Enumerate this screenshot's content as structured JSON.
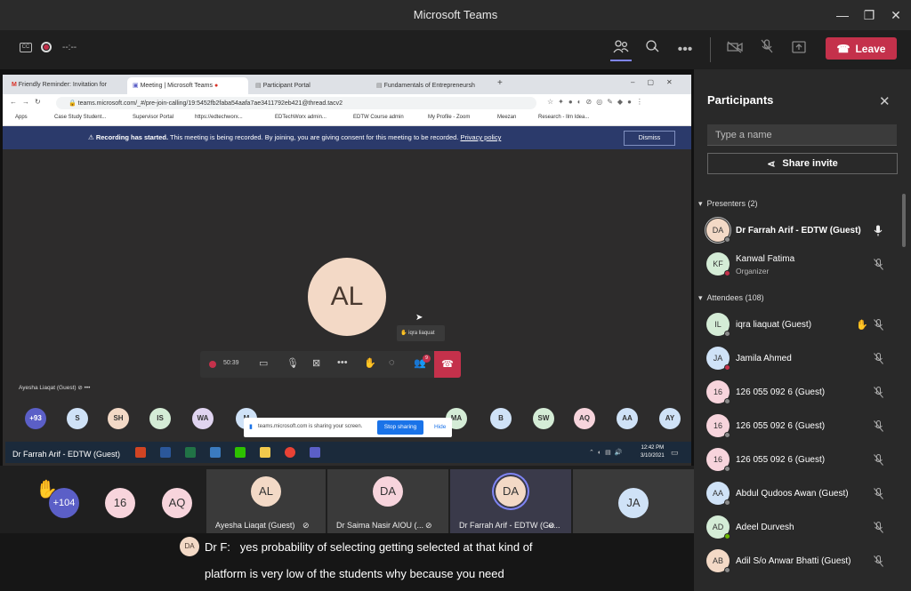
{
  "titlebar": {
    "title": "Microsoft Teams",
    "minimize": "—",
    "maximize": "❐",
    "close": "✕"
  },
  "meeting": {
    "timer": "--:--",
    "cc_icon": "cc-icon",
    "leave_label": "Leave",
    "leave_color": "#c4314b"
  },
  "browser": {
    "tabs": [
      "Friendly Reminder: Invitation for",
      "Meeting | Microsoft Teams",
      "Participant Portal",
      "Fundamentals of Entrepreneursh"
    ],
    "url": "teams.microsoft.com/_#/pre-join-calling/19:5452fb2faba54aafa7ae3411792eb421@thread.tacv2",
    "bookmarks": [
      "Apps",
      "Case Study Student...",
      "Supervisor Portal",
      "https://edtechworx...",
      "EDTechWorx admin...",
      "EDTW Course admin",
      "My Profile - Zoom",
      "Meezan",
      "Research - Ilm Idea..."
    ],
    "recording_bold": "Recording has started.",
    "recording_text": " This meeting is being recorded. By joining, you are giving consent for this meeting to be recorded. ",
    "privacy_link": "Privacy policy",
    "dismiss": "Dismiss",
    "big_avatar": "AL",
    "hand_tip": "iqra liaquat",
    "call_time": "50:39",
    "call_badge": "9",
    "speaker_label": "Ayesha Liaqat (Guest)",
    "mini_avatars": [
      {
        "t": "+93",
        "c": "#5b5fc7"
      },
      {
        "t": "S",
        "c": "#cfe2f7"
      },
      {
        "t": "SH",
        "c": "#f3d9c6"
      },
      {
        "t": "IS",
        "c": "#d4ecd6"
      },
      {
        "t": "WA",
        "c": "#e0d4f0"
      },
      {
        "t": "M",
        "c": "#cfe2f7"
      },
      {
        "t": "MA",
        "c": "#d4ecd6"
      },
      {
        "t": "B",
        "c": "#cfe2f7"
      },
      {
        "t": "SW",
        "c": "#d4ecd6"
      },
      {
        "t": "AQ",
        "c": "#f7d4dc"
      },
      {
        "t": "AA",
        "c": "#cfe2f7"
      },
      {
        "t": "AY",
        "c": "#cfe2f7"
      }
    ],
    "share_msg": "teams.microsoft.com is sharing your screen.",
    "stop_sharing": "Stop sharing",
    "hide": "Hide",
    "taskbar_label": "Dr Farrah Arif - EDTW (Guest)",
    "clock_time": "12:42 PM",
    "clock_date": "3/10/2021"
  },
  "strip": [
    {
      "t": "+104",
      "c": "#5b5fc7",
      "label": ""
    },
    {
      "t": "16",
      "c": "#f7d4dc",
      "label": ""
    },
    {
      "t": "AQ",
      "c": "#f7d4dc",
      "label": ""
    },
    {
      "t": "AL",
      "c": "#f3d9c6",
      "label": "Ayesha Liaqat (Guest)"
    },
    {
      "t": "DA",
      "c": "#f7d4dc",
      "label": "Dr Saima Nasir AIOU (..."
    },
    {
      "t": "DA",
      "c": "#f3d9c6",
      "label": "Dr Farrah Arif - EDTW (Gu..."
    },
    {
      "t": "JA",
      "c": "#cfe2f7",
      "label": ""
    }
  ],
  "caption": {
    "avatar": "DA",
    "speaker": "Dr F:",
    "line1": "yes probability of selecting getting selected at that kind of",
    "line2": "platform is very low of the students why because you need"
  },
  "panel": {
    "title": "Participants",
    "search_placeholder": "Type a name",
    "share_invite": "Share invite",
    "presenters_label": "Presenters (2)",
    "attendees_label": "Attendees (108)",
    "presenters": [
      {
        "initials": "DA",
        "name": "Dr Farrah Arif - EDTW (Guest)",
        "sub": "",
        "color": "#f3d9c6",
        "mic": "mic-on-icon",
        "status": "#8a8a8a",
        "bold": true
      },
      {
        "initials": "KF",
        "name": "Kanwal Fatima",
        "sub": "Organizer",
        "color": "#d4ecd6",
        "mic": "mic-off-icon",
        "status": "#c4314b",
        "bold": false
      }
    ],
    "attendees": [
      {
        "initials": "IL",
        "name": "iqra liaquat (Guest)",
        "color": "#d4ecd6",
        "status": "#8a8a8a",
        "hand": true
      },
      {
        "initials": "JA",
        "name": "Jamila Ahmed",
        "color": "#cfe2f7",
        "status": "#c4314b",
        "hand": false
      },
      {
        "initials": "16",
        "name": "126 055 092 6 (Guest)",
        "color": "#f7d4dc",
        "status": "#8a8a8a",
        "hand": false
      },
      {
        "initials": "16",
        "name": "126 055 092 6 (Guest)",
        "color": "#f7d4dc",
        "status": "#8a8a8a",
        "hand": false
      },
      {
        "initials": "16",
        "name": "126 055 092 6 (Guest)",
        "color": "#f7d4dc",
        "status": "#8a8a8a",
        "hand": false
      },
      {
        "initials": "AA",
        "name": "Abdul Qudoos Awan (Guest)",
        "color": "#cfe2f7",
        "status": "#8a8a8a",
        "hand": false
      },
      {
        "initials": "AD",
        "name": "Adeel Durvesh",
        "color": "#d4ecd6",
        "status": "#6bb700",
        "hand": false
      },
      {
        "initials": "AB",
        "name": "Adil S/o Anwar Bhatti (Guest)",
        "color": "#f3d9c6",
        "status": "#8a8a8a",
        "hand": false
      }
    ]
  }
}
